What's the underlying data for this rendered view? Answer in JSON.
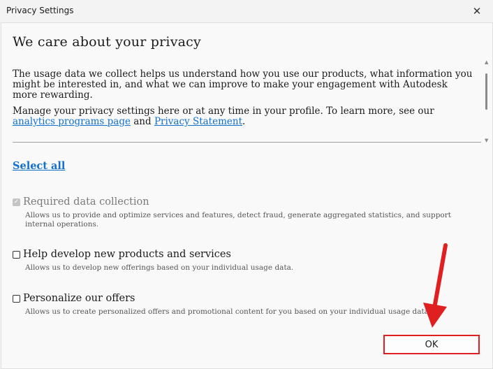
{
  "window": {
    "title": "Privacy Settings",
    "close_symbol": "✕"
  },
  "heading": "We care about your privacy",
  "intro": {
    "para1": "The usage data we collect helps us understand how you use our products, what information you might be interested in, and what we can improve to make your engagement with Autodesk more rewarding.",
    "para2_start": "Manage your privacy settings here or at any time in your profile. To learn more, see our ",
    "link1": "analytics programs page",
    "para2_mid": " and ",
    "link2": "Privacy Statement",
    "para2_end": "."
  },
  "select_all": "Select all",
  "options": [
    {
      "label": "Required data collection",
      "description": "Allows us to provide and optimize services and features, detect fraud, generate aggregated statistics, and support internal operations.",
      "checked": true,
      "disabled": true
    },
    {
      "label": "Help develop new products and services",
      "description": "Allows us to develop new offerings based on your individual usage data.",
      "checked": false,
      "disabled": false
    },
    {
      "label": "Personalize our offers",
      "description": "Allows us to create personalized offers and promotional content for you based on your individual usage data.",
      "checked": false,
      "disabled": false
    }
  ],
  "ok_label": "OK",
  "colors": {
    "link": "#1170cf",
    "highlight": "#e02020",
    "background": "#f9f9f9"
  }
}
